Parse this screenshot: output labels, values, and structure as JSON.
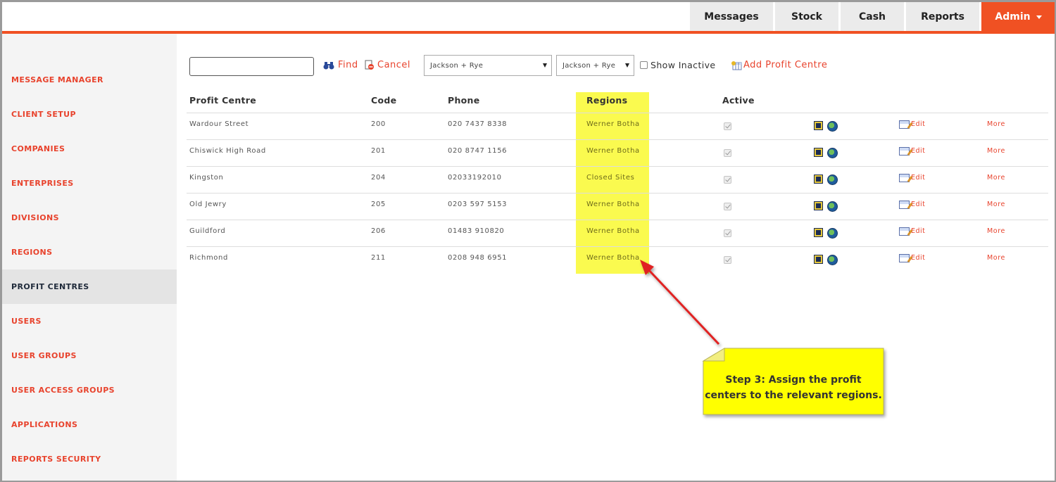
{
  "nav": {
    "items": [
      "Messages",
      "Stock",
      "Cash",
      "Reports"
    ],
    "admin_label": "Admin"
  },
  "sidebar": {
    "items": [
      {
        "label": "MESSAGE MANAGER"
      },
      {
        "label": "CLIENT SETUP"
      },
      {
        "label": "COMPANIES"
      },
      {
        "label": "ENTERPRISES"
      },
      {
        "label": "DIVISIONS"
      },
      {
        "label": "REGIONS"
      },
      {
        "label": "PROFIT CENTRES",
        "active": true
      },
      {
        "label": "USERS"
      },
      {
        "label": "USER GROUPS"
      },
      {
        "label": "USER ACCESS GROUPS"
      },
      {
        "label": "APPLICATIONS"
      },
      {
        "label": "REPORTS SECURITY"
      }
    ]
  },
  "toolbar": {
    "search_value": "",
    "find_label": "Find",
    "cancel_label": "Cancel",
    "select1_value": "Jackson + Rye",
    "select2_value": "Jackson + Rye",
    "show_inactive_label": "Show Inactive",
    "add_label": "Add Profit Centre"
  },
  "table": {
    "headers": {
      "profit_centre": "Profit Centre",
      "code": "Code",
      "phone": "Phone",
      "regions": "Regions",
      "active": "Active"
    },
    "rows": [
      {
        "name": "Wardour Street",
        "code": "200",
        "phone": "020 7437 8338",
        "region": "Werner Botha",
        "active": true
      },
      {
        "name": "Chiswick High Road",
        "code": "201",
        "phone": "020 8747 1156",
        "region": "Werner Botha",
        "active": true
      },
      {
        "name": "Kingston",
        "code": "204",
        "phone": "02033192010",
        "region": "Closed Sites",
        "active": true
      },
      {
        "name": "Old Jewry",
        "code": "205",
        "phone": "0203 597 5153",
        "region": "Werner Botha",
        "active": true
      },
      {
        "name": "Guildford",
        "code": "206",
        "phone": "01483 910820",
        "region": "Werner Botha",
        "active": true
      },
      {
        "name": "Richmond",
        "code": "211",
        "phone": "0208 948 6951",
        "region": "Werner Botha",
        "active": true
      }
    ],
    "edit_label": "Edit",
    "more_label": "More"
  },
  "annotation": {
    "line1": "Step 3: Assign the profit",
    "line2": "centers to the relevant regions."
  },
  "colors": {
    "accent": "#f05123",
    "highlight": "#fafa4f",
    "link": "#e8432d"
  }
}
